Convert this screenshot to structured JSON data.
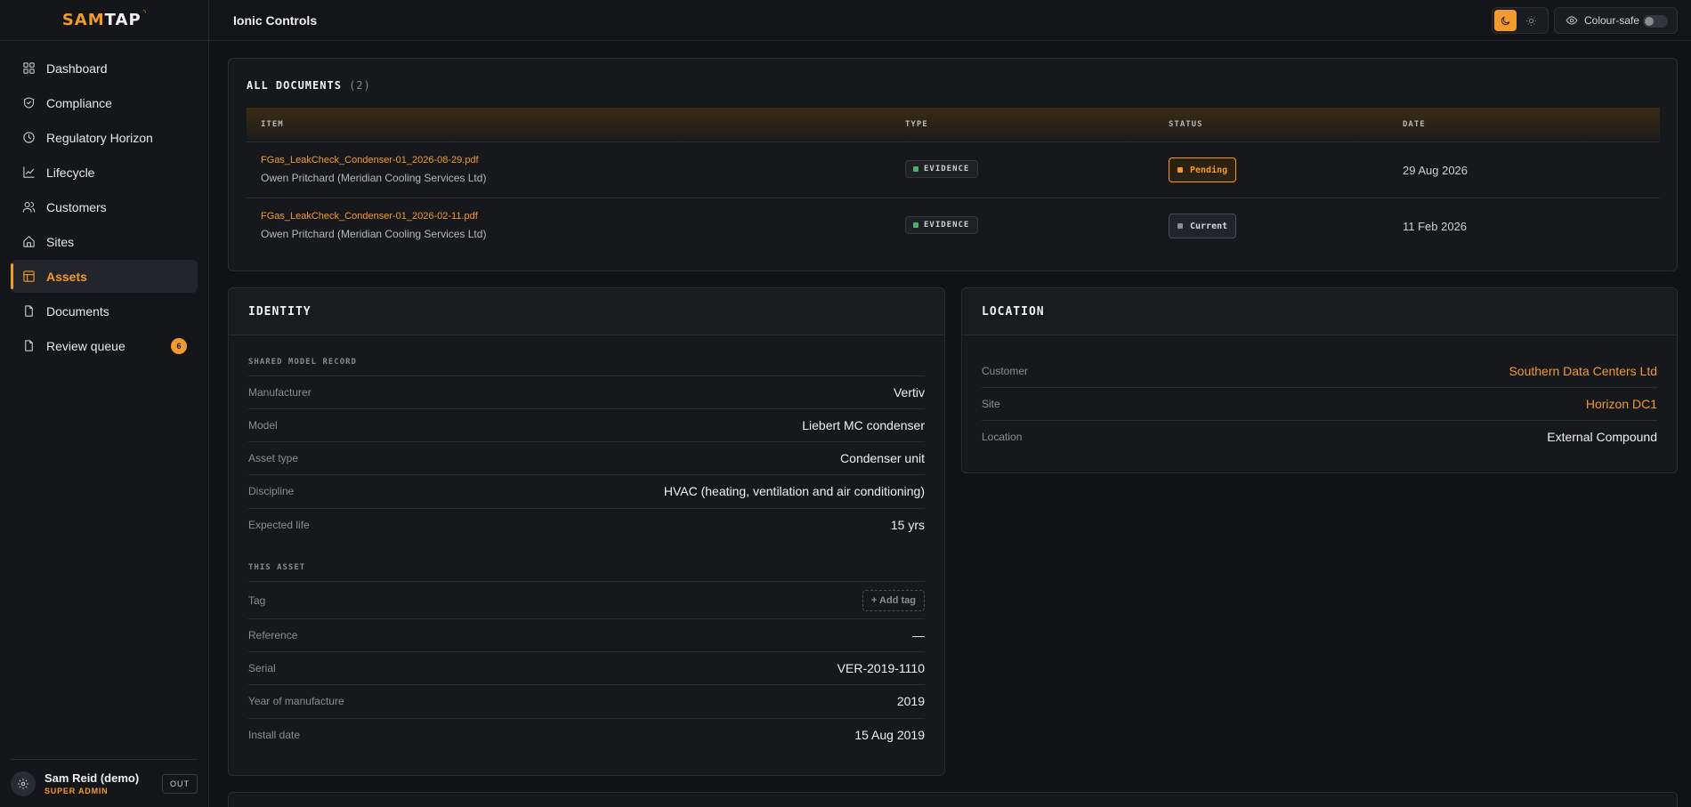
{
  "brand": {
    "sam": "SAM",
    "tap": "TAP"
  },
  "topbar": {
    "title": "Ionic Controls",
    "colour_safe_label": "Colour-safe"
  },
  "sidebar": {
    "items": [
      {
        "label": "Dashboard",
        "icon": "grid-icon"
      },
      {
        "label": "Compliance",
        "icon": "shield-icon"
      },
      {
        "label": "Regulatory Horizon",
        "icon": "clock-icon"
      },
      {
        "label": "Lifecycle",
        "icon": "trend-icon"
      },
      {
        "label": "Customers",
        "icon": "users-icon"
      },
      {
        "label": "Sites",
        "icon": "home-icon"
      },
      {
        "label": "Assets",
        "icon": "layout-icon",
        "active": true
      },
      {
        "label": "Documents",
        "icon": "document-icon"
      },
      {
        "label": "Review queue",
        "icon": "document-icon",
        "badge": "6"
      }
    ],
    "user": {
      "name": "Sam Reid (demo)",
      "role": "SUPER ADMIN",
      "out_label": "OUT"
    }
  },
  "documents": {
    "title": "ALL DOCUMENTS",
    "count": "(2)",
    "headers": {
      "item": "ITEM",
      "type": "TYPE",
      "status": "STATUS",
      "date": "DATE"
    },
    "rows": [
      {
        "file": "FGas_LeakCheck_Condenser-01_2026-08-29.pdf",
        "by": "Owen Pritchard (Meridian Cooling Services Ltd)",
        "type": "EVIDENCE",
        "status": "Pending",
        "date": "29 Aug 2026"
      },
      {
        "file": "FGas_LeakCheck_Condenser-01_2026-02-11.pdf",
        "by": "Owen Pritchard (Meridian Cooling Services Ltd)",
        "type": "EVIDENCE",
        "status": "Current",
        "date": "11 Feb 2026"
      }
    ]
  },
  "identity": {
    "title": "IDENTITY",
    "shared_label": "SHARED MODEL RECORD",
    "manufacturer": {
      "k": "Manufacturer",
      "v": "Vertiv"
    },
    "model": {
      "k": "Model",
      "v": "Liebert MC condenser"
    },
    "asset_type": {
      "k": "Asset type",
      "v": "Condenser unit"
    },
    "discipline": {
      "k": "Discipline",
      "v": "HVAC (heating, ventilation and air conditioning)"
    },
    "expected_life": {
      "k": "Expected life",
      "v": "15 yrs"
    },
    "this_label": "THIS ASSET",
    "tag": {
      "k": "Tag",
      "v": "+ Add tag"
    },
    "reference": {
      "k": "Reference",
      "v": "—"
    },
    "serial": {
      "k": "Serial",
      "v": "VER-2019-1110"
    },
    "year": {
      "k": "Year of manufacture",
      "v": "2019"
    },
    "install": {
      "k": "Install date",
      "v": "15 Aug 2019"
    }
  },
  "location": {
    "title": "LOCATION",
    "customer": {
      "k": "Customer",
      "v": "Southern Data Centers Ltd"
    },
    "site": {
      "k": "Site",
      "v": "Horizon DC1"
    },
    "location": {
      "k": "Location",
      "v": "External Compound"
    }
  },
  "colors": {
    "accent": "#f29a2e",
    "bg": "#111215",
    "card": "#17181c"
  }
}
